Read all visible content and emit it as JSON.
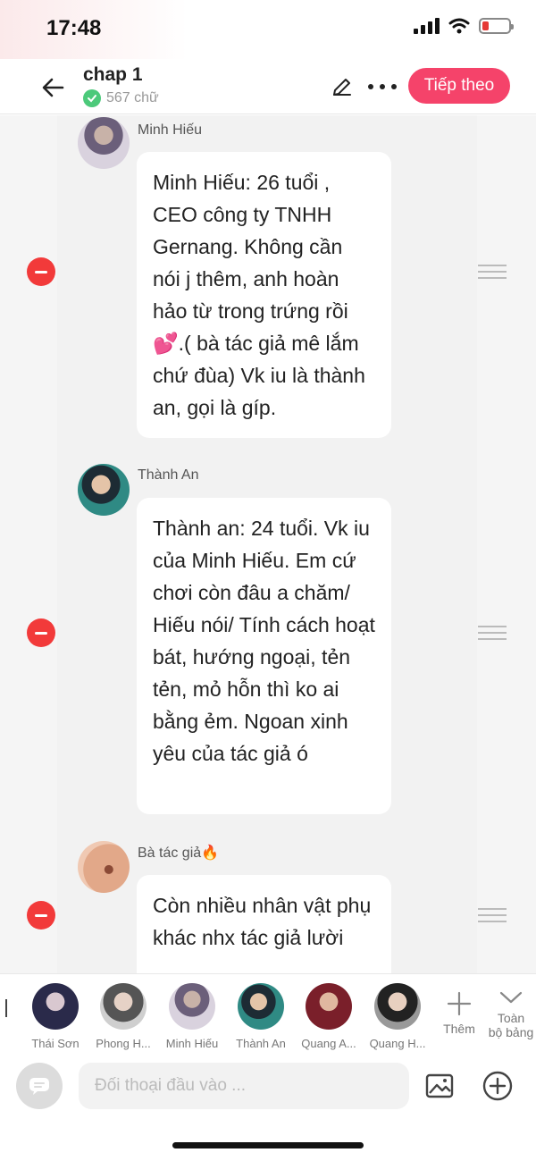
{
  "status_bar": {
    "time": "17:48"
  },
  "header": {
    "title": "chap 1",
    "word_count": "567 chữ",
    "next_label": "Tiếp theo"
  },
  "messages": [
    {
      "speaker": "Minh Hiếu",
      "text": "Minh Hiếu: 26 tuổi , CEO công ty TNHH Gernang. Không cần nói j thêm, anh hoàn hảo từ trong trứng rồi 💕.( bà tác giả mê lắm chứ đùa) Vk iu là thành an, gọi là gíp."
    },
    {
      "speaker": "Thành An",
      "text": "Thành an: 24 tuổi. Vk iu của Minh Hiếu. Em cứ chơi còn đâu a chăm/ Hiếu nói/ Tính cách hoạt bát, hướng ngoại, tẻn tẻn, mỏ hỗn thì ko ai bằng ẻm. Ngoan xinh yêu của tác giả ó"
    },
    {
      "speaker": "Bà tác giả🔥",
      "text": "Còn nhiều nhân vật phụ khác nhx tác giả lười"
    }
  ],
  "characters": [
    {
      "name": "Thái Sơn"
    },
    {
      "name": "Phong H..."
    },
    {
      "name": "Minh Hiếu"
    },
    {
      "name": "Thành An"
    },
    {
      "name": "Quang A..."
    },
    {
      "name": "Quang H..."
    }
  ],
  "character_bar": {
    "add_label": "Thêm",
    "expand_label_1": "Toàn",
    "expand_label_2": "bộ bảng"
  },
  "input": {
    "placeholder": "Đối thoại đầu vào ..."
  },
  "colors": {
    "accent": "#f5436a",
    "remove": "#f23a3a",
    "check": "#4cc97a"
  }
}
